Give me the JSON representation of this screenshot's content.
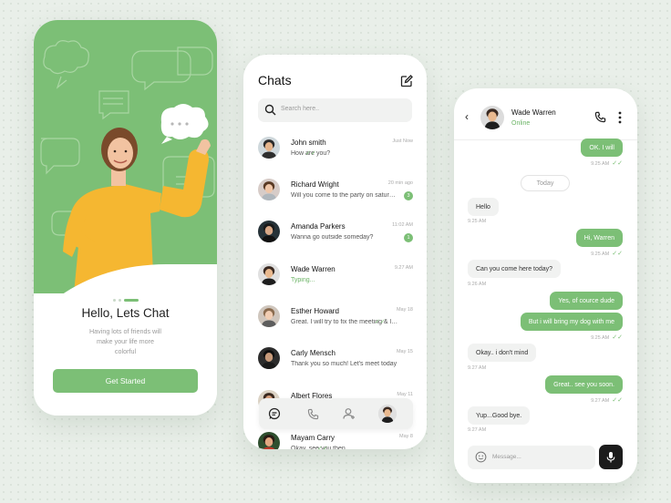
{
  "onboarding": {
    "title": "Hello, Lets Chat",
    "subtitle": "Having lots of friends will make your life more colorful",
    "cta": "Get Started"
  },
  "chats": {
    "title": "Chats",
    "search_placeholder": "Search here..",
    "list": [
      {
        "name": "John smith",
        "message": "How are you?",
        "time": "Just Now",
        "badge": "",
        "typing": false,
        "read": true
      },
      {
        "name": "Richard Wright",
        "message": "Will you come to the party on saturday?",
        "time": "20 min ago",
        "badge": "3",
        "typing": false,
        "read": false
      },
      {
        "name": "Amanda Parkers",
        "message": "Wanna go outside someday?",
        "time": "11:02 AM",
        "badge": "1",
        "typing": false,
        "read": false
      },
      {
        "name": "Wade Warren",
        "message": "Typing...",
        "time": "9.27 AM",
        "badge": "",
        "typing": true,
        "read": false
      },
      {
        "name": "Esther Howard",
        "message": "Great. I will try to fix the meeting & let you know",
        "time": "May 18",
        "badge": "",
        "typing": false,
        "read": true
      },
      {
        "name": "Carly Mensch",
        "message": "Thank you so much! Let's meet today",
        "time": "May 15",
        "badge": "",
        "typing": false,
        "read": false
      },
      {
        "name": "Albert Flores",
        "message": "",
        "time": "May 11",
        "badge": "",
        "typing": false,
        "read": false
      },
      {
        "name": "Mayam Carry",
        "message": "Okay, see you then",
        "time": "May 8",
        "badge": "",
        "typing": false,
        "read": true
      }
    ]
  },
  "conversation": {
    "contact": "Wade Warren",
    "status": "Online",
    "date_divider": "Today",
    "input_placeholder": "Message...",
    "messages": [
      {
        "dir": "out",
        "text": "OK. I will",
        "time": "9.25 AM"
      },
      {
        "dir": "in",
        "text": "Hello",
        "time": "9.25 AM"
      },
      {
        "dir": "out",
        "text": "Hi, Warren",
        "time": "9.25 AM"
      },
      {
        "dir": "in",
        "text": "Can you come here today?",
        "time": "9.26 AM"
      },
      {
        "dir": "out",
        "text": "Yes, of cource dude",
        "time": ""
      },
      {
        "dir": "out",
        "text": "But i will bring my dog with me",
        "time": "9.25 AM"
      },
      {
        "dir": "in",
        "text": "Okay.. i don't mind",
        "time": "9.27 AM"
      },
      {
        "dir": "out",
        "text": "Great.. see you soon.",
        "time": "9.27 AM"
      },
      {
        "dir": "in",
        "text": "Yup...Good bye.",
        "time": "9.27 AM"
      }
    ]
  },
  "colors": {
    "accent": "#7cbf76",
    "dark": "#1c1c1c",
    "background": "#e9efe9"
  }
}
